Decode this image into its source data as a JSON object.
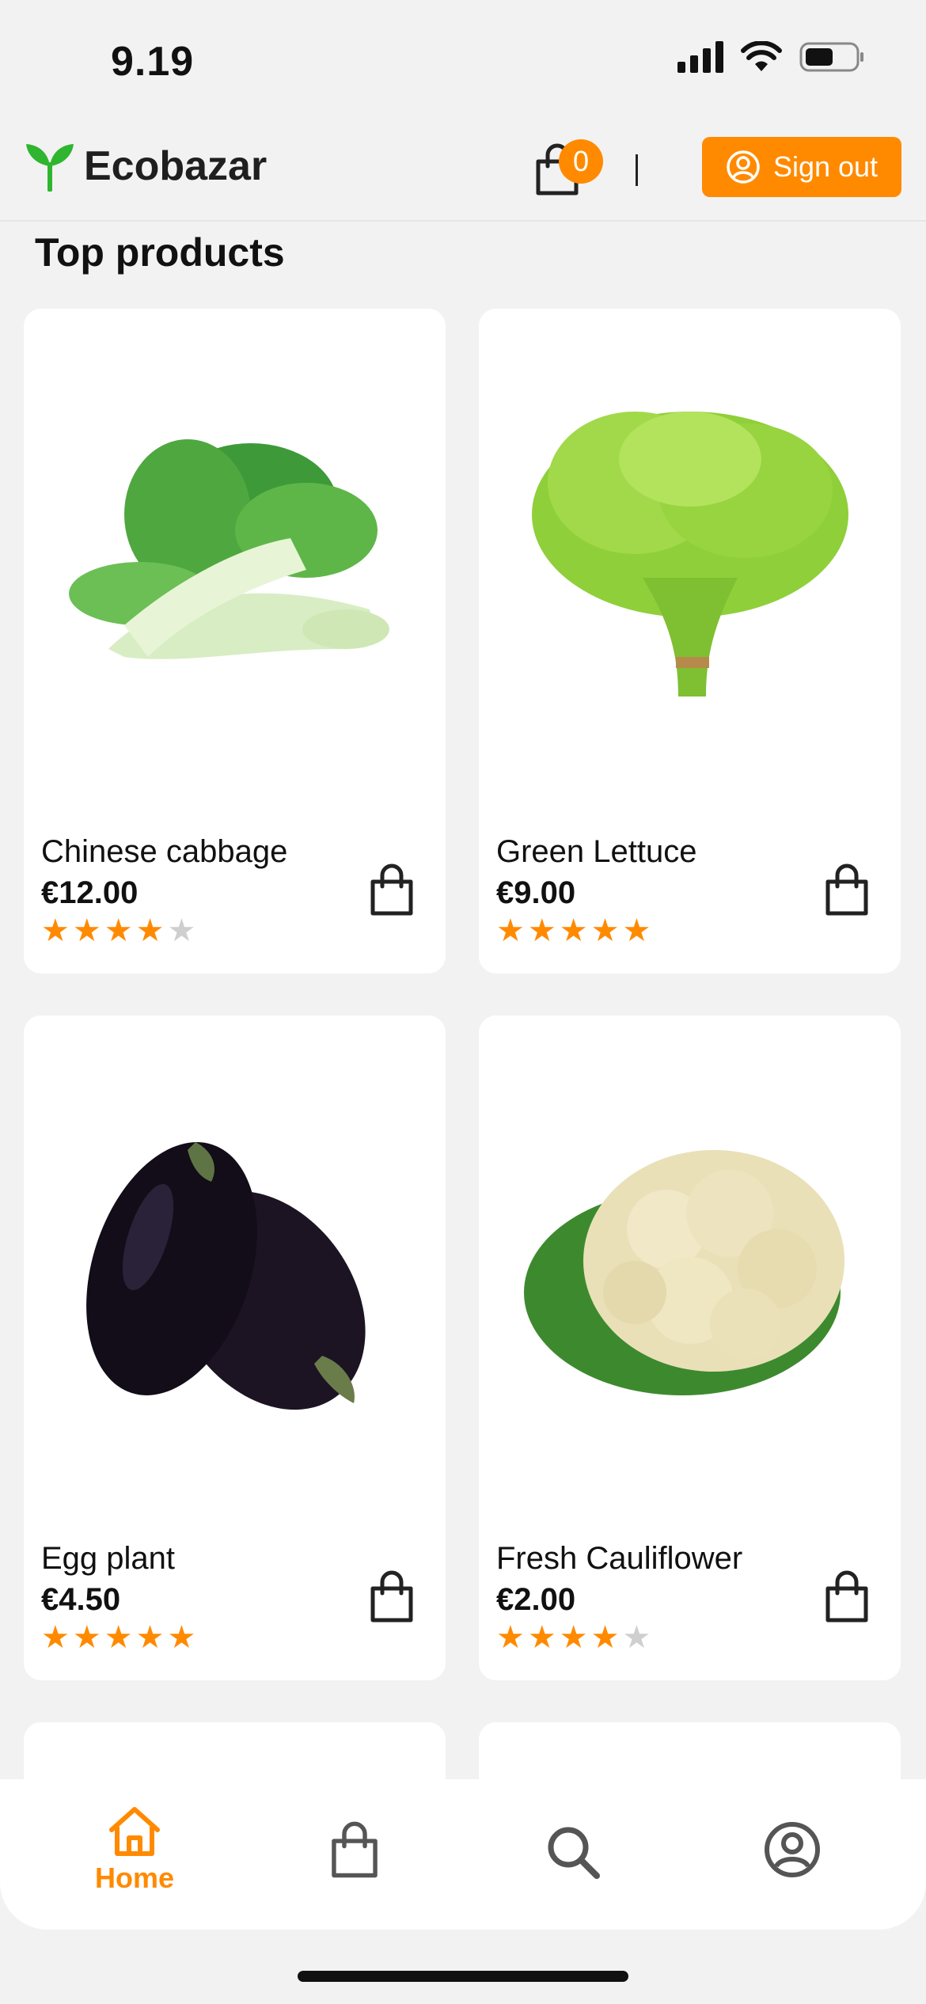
{
  "status_bar": {
    "time": "9.19"
  },
  "header": {
    "brand": "Ecobazar",
    "cart_count": "0",
    "separator": "|",
    "signout_label": "Sign out"
  },
  "section": {
    "title": "Top products"
  },
  "products": [
    {
      "name": "Chinese cabbage",
      "price": "€12.00",
      "rating": 4
    },
    {
      "name": "Green Lettuce",
      "price": "€9.00",
      "rating": 5
    },
    {
      "name": "Egg plant",
      "price": "€4.50",
      "rating": 5
    },
    {
      "name": "Fresh Cauliflower",
      "price": "€2.00",
      "rating": 4
    }
  ],
  "bottom_nav": {
    "home_label": "Home",
    "icons": [
      "home-icon",
      "shopping-bag-icon",
      "search-icon",
      "user-icon"
    ]
  },
  "colors": {
    "accent": "#ff8a00",
    "star_on": "#ff8a00",
    "star_off": "#cfcfcf",
    "brand_green": "#2fb52f"
  }
}
